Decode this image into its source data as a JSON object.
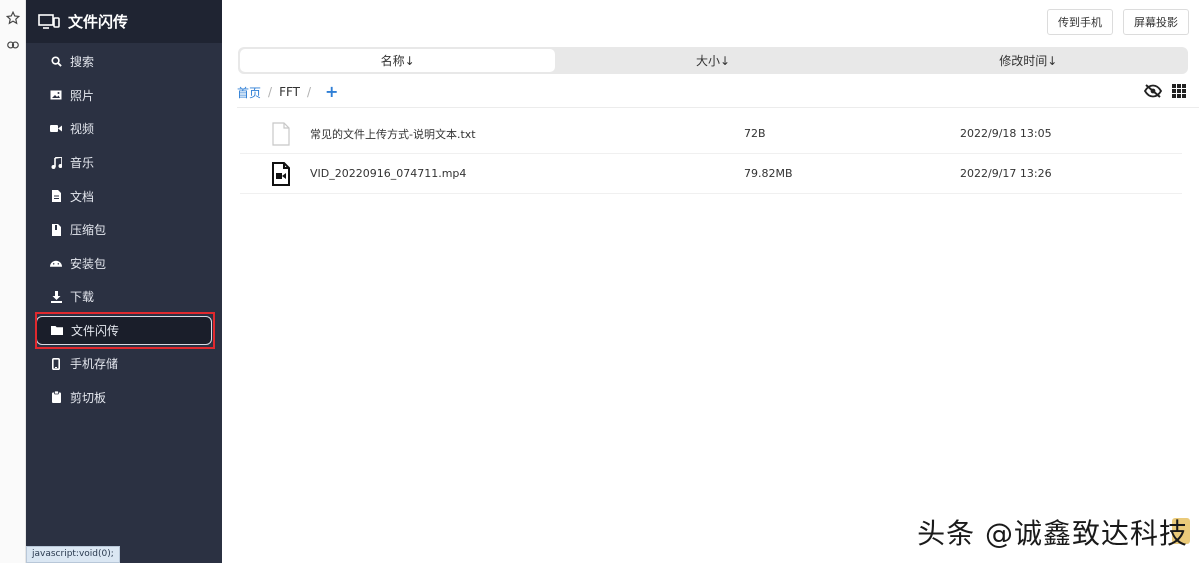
{
  "sidebar": {
    "title": "文件闪传",
    "items": [
      {
        "label": "搜索",
        "icon": "search-icon"
      },
      {
        "label": "照片",
        "icon": "image-icon"
      },
      {
        "label": "视频",
        "icon": "video-icon"
      },
      {
        "label": "音乐",
        "icon": "music-icon"
      },
      {
        "label": "文档",
        "icon": "document-icon"
      },
      {
        "label": "压缩包",
        "icon": "archive-icon"
      },
      {
        "label": "安装包",
        "icon": "android-icon"
      },
      {
        "label": "下载",
        "icon": "download-icon"
      },
      {
        "label": "文件闪传",
        "icon": "folder-icon",
        "active": true
      },
      {
        "label": "手机存储",
        "icon": "phone-icon"
      },
      {
        "label": "剪切板",
        "icon": "clipboard-icon"
      }
    ]
  },
  "toolbar": {
    "send_to_phone": "传到手机",
    "screen_cast": "屏幕投影"
  },
  "sort": {
    "name": "名称↓",
    "size": "大小↓",
    "modified": "修改时间↓"
  },
  "breadcrumb": {
    "home": "首页",
    "separator": "/",
    "current": "FFT",
    "add": "+"
  },
  "files": [
    {
      "name": "常见的文件上传方式-说明文本.txt",
      "size": "72B",
      "date": "2022/9/18 13:05",
      "icon": "text-file-icon"
    },
    {
      "name": "VID_20220916_074711.mp4",
      "size": "79.82MB",
      "date": "2022/9/17 13:26",
      "icon": "video-file-icon"
    }
  ],
  "status_bar": "javascript:void(0);",
  "watermark": "头条 @诚鑫致达科技",
  "colors": {
    "sidebar_bg": "#2b3142",
    "sidebar_header_bg": "#1f2432",
    "link": "#2f7fd6",
    "highlight": "#e0292e"
  }
}
